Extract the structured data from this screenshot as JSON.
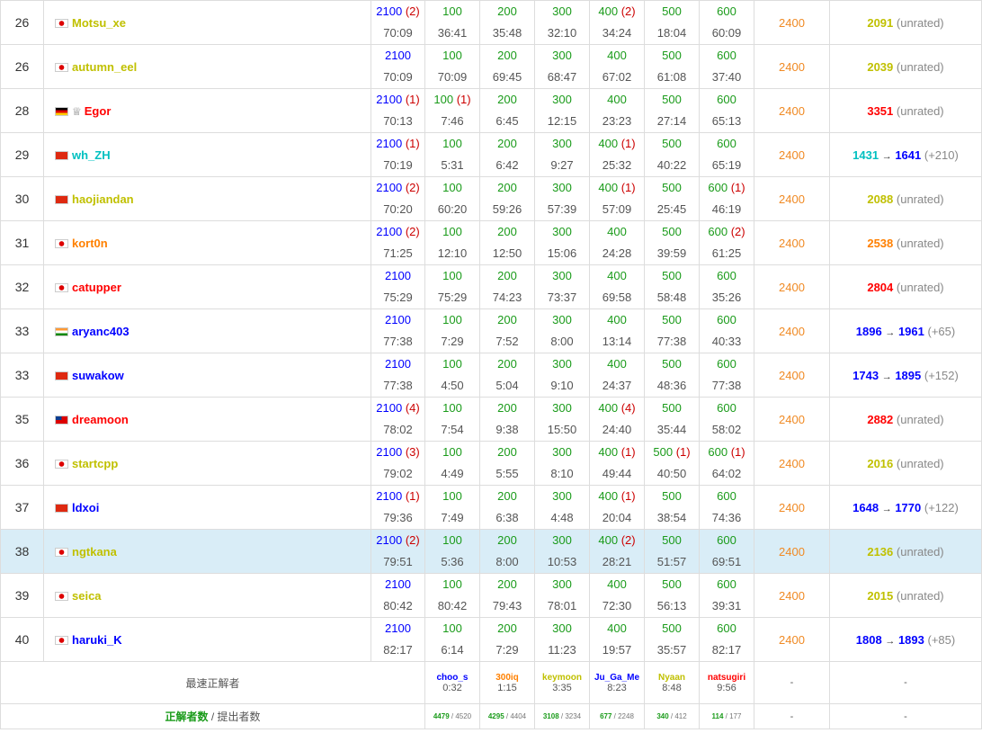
{
  "rows": [
    {
      "rank": "26",
      "flag": "jp",
      "crown": false,
      "name": "Motsu_xe",
      "color": "#c0c000",
      "highlight": false,
      "problems": [
        [
          "2100",
          "(2)",
          "70:09"
        ],
        [
          "100",
          "",
          "36:41"
        ],
        [
          "200",
          "",
          "35:48"
        ],
        [
          "300",
          "",
          "32:10"
        ],
        [
          "400",
          "(2)",
          "34:24"
        ],
        [
          "500",
          "",
          "18:04"
        ],
        [
          "600",
          "",
          "60:09"
        ]
      ],
      "score": "2400",
      "rating": {
        "perf": "2091",
        "perf_color": "#c0c000",
        "old": "",
        "new": "",
        "delta": "",
        "unrated": "(unrated)"
      }
    },
    {
      "rank": "26",
      "flag": "jp",
      "crown": false,
      "name": "autumn_eel",
      "color": "#c0c000",
      "highlight": false,
      "problems": [
        [
          "2100",
          "",
          "70:09"
        ],
        [
          "100",
          "",
          "70:09"
        ],
        [
          "200",
          "",
          "69:45"
        ],
        [
          "300",
          "",
          "68:47"
        ],
        [
          "400",
          "",
          "67:02"
        ],
        [
          "500",
          "",
          "61:08"
        ],
        [
          "600",
          "",
          "37:40"
        ]
      ],
      "score": "2400",
      "rating": {
        "perf": "2039",
        "perf_color": "#c0c000",
        "old": "",
        "new": "",
        "delta": "",
        "unrated": "(unrated)"
      }
    },
    {
      "rank": "28",
      "flag": "de",
      "crown": true,
      "name": "Egor",
      "color": "#ff0000",
      "highlight": false,
      "problems": [
        [
          "2100",
          "(1)",
          "70:13"
        ],
        [
          "100",
          "(1)",
          "7:46"
        ],
        [
          "200",
          "",
          "6:45"
        ],
        [
          "300",
          "",
          "12:15"
        ],
        [
          "400",
          "",
          "23:23"
        ],
        [
          "500",
          "",
          "27:14"
        ],
        [
          "600",
          "",
          "65:13"
        ]
      ],
      "score": "2400",
      "rating": {
        "perf": "3351",
        "perf_color": "#ff0000",
        "old": "",
        "new": "",
        "delta": "",
        "unrated": "(unrated)"
      }
    },
    {
      "rank": "29",
      "flag": "cn",
      "crown": false,
      "name": "wh_ZH",
      "color": "#00c0c0",
      "highlight": false,
      "problems": [
        [
          "2100",
          "(1)",
          "70:19"
        ],
        [
          "100",
          "",
          "5:31"
        ],
        [
          "200",
          "",
          "6:42"
        ],
        [
          "300",
          "",
          "9:27"
        ],
        [
          "400",
          "(1)",
          "25:32"
        ],
        [
          "500",
          "",
          "40:22"
        ],
        [
          "600",
          "",
          "65:19"
        ]
      ],
      "score": "2400",
      "rating": {
        "perf": "",
        "perf_color": "",
        "old": "1431",
        "old_color": "#00c0c0",
        "new": "1641",
        "new_color": "#0000ff",
        "delta": "(+210)",
        "unrated": ""
      }
    },
    {
      "rank": "30",
      "flag": "cn",
      "crown": false,
      "name": "haojiandan",
      "color": "#c0c000",
      "highlight": false,
      "problems": [
        [
          "2100",
          "(2)",
          "70:20"
        ],
        [
          "100",
          "",
          "60:20"
        ],
        [
          "200",
          "",
          "59:26"
        ],
        [
          "300",
          "",
          "57:39"
        ],
        [
          "400",
          "(1)",
          "57:09"
        ],
        [
          "500",
          "",
          "25:45"
        ],
        [
          "600",
          "(1)",
          "46:19"
        ]
      ],
      "score": "2400",
      "rating": {
        "perf": "2088",
        "perf_color": "#c0c000",
        "old": "",
        "new": "",
        "delta": "",
        "unrated": "(unrated)"
      }
    },
    {
      "rank": "31",
      "flag": "jp",
      "crown": false,
      "name": "kort0n",
      "color": "#ff8000",
      "highlight": false,
      "problems": [
        [
          "2100",
          "(2)",
          "71:25"
        ],
        [
          "100",
          "",
          "12:10"
        ],
        [
          "200",
          "",
          "12:50"
        ],
        [
          "300",
          "",
          "15:06"
        ],
        [
          "400",
          "",
          "24:28"
        ],
        [
          "500",
          "",
          "39:59"
        ],
        [
          "600",
          "(2)",
          "61:25"
        ]
      ],
      "score": "2400",
      "rating": {
        "perf": "2538",
        "perf_color": "#ff8000",
        "old": "",
        "new": "",
        "delta": "",
        "unrated": "(unrated)"
      }
    },
    {
      "rank": "32",
      "flag": "jp",
      "crown": false,
      "name": "catupper",
      "color": "#ff0000",
      "highlight": false,
      "problems": [
        [
          "2100",
          "",
          "75:29"
        ],
        [
          "100",
          "",
          "75:29"
        ],
        [
          "200",
          "",
          "74:23"
        ],
        [
          "300",
          "",
          "73:37"
        ],
        [
          "400",
          "",
          "69:58"
        ],
        [
          "500",
          "",
          "58:48"
        ],
        [
          "600",
          "",
          "35:26"
        ]
      ],
      "score": "2400",
      "rating": {
        "perf": "2804",
        "perf_color": "#ff0000",
        "old": "",
        "new": "",
        "delta": "",
        "unrated": "(unrated)"
      }
    },
    {
      "rank": "33",
      "flag": "in",
      "crown": false,
      "name": "aryanc403",
      "color": "#0000ff",
      "highlight": false,
      "problems": [
        [
          "2100",
          "",
          "77:38"
        ],
        [
          "100",
          "",
          "7:29"
        ],
        [
          "200",
          "",
          "7:52"
        ],
        [
          "300",
          "",
          "8:00"
        ],
        [
          "400",
          "",
          "13:14"
        ],
        [
          "500",
          "",
          "77:38"
        ],
        [
          "600",
          "",
          "40:33"
        ]
      ],
      "score": "2400",
      "rating": {
        "perf": "",
        "perf_color": "",
        "old": "1896",
        "old_color": "#0000ff",
        "new": "1961",
        "new_color": "#0000ff",
        "delta": "(+65)",
        "unrated": ""
      }
    },
    {
      "rank": "33",
      "flag": "cn",
      "crown": false,
      "name": "suwakow",
      "color": "#0000ff",
      "highlight": false,
      "problems": [
        [
          "2100",
          "",
          "77:38"
        ],
        [
          "100",
          "",
          "4:50"
        ],
        [
          "200",
          "",
          "5:04"
        ],
        [
          "300",
          "",
          "9:10"
        ],
        [
          "400",
          "",
          "24:37"
        ],
        [
          "500",
          "",
          "48:36"
        ],
        [
          "600",
          "",
          "77:38"
        ]
      ],
      "score": "2400",
      "rating": {
        "perf": "",
        "perf_color": "",
        "old": "1743",
        "old_color": "#0000ff",
        "new": "1895",
        "new_color": "#0000ff",
        "delta": "(+152)",
        "unrated": ""
      }
    },
    {
      "rank": "35",
      "flag": "tw",
      "crown": false,
      "name": "dreamoon",
      "color": "#ff0000",
      "highlight": false,
      "problems": [
        [
          "2100",
          "(4)",
          "78:02"
        ],
        [
          "100",
          "",
          "7:54"
        ],
        [
          "200",
          "",
          "9:38"
        ],
        [
          "300",
          "",
          "15:50"
        ],
        [
          "400",
          "(4)",
          "24:40"
        ],
        [
          "500",
          "",
          "35:44"
        ],
        [
          "600",
          "",
          "58:02"
        ]
      ],
      "score": "2400",
      "rating": {
        "perf": "2882",
        "perf_color": "#ff0000",
        "old": "",
        "new": "",
        "delta": "",
        "unrated": "(unrated)"
      }
    },
    {
      "rank": "36",
      "flag": "jp",
      "crown": false,
      "name": "startcpp",
      "color": "#c0c000",
      "highlight": false,
      "problems": [
        [
          "2100",
          "(3)",
          "79:02"
        ],
        [
          "100",
          "",
          "4:49"
        ],
        [
          "200",
          "",
          "5:55"
        ],
        [
          "300",
          "",
          "8:10"
        ],
        [
          "400",
          "(1)",
          "49:44"
        ],
        [
          "500",
          "(1)",
          "40:50"
        ],
        [
          "600",
          "(1)",
          "64:02"
        ]
      ],
      "score": "2400",
      "rating": {
        "perf": "2016",
        "perf_color": "#c0c000",
        "old": "",
        "new": "",
        "delta": "",
        "unrated": "(unrated)"
      }
    },
    {
      "rank": "37",
      "flag": "cn",
      "crown": false,
      "name": "ldxoi",
      "color": "#0000ff",
      "highlight": false,
      "problems": [
        [
          "2100",
          "(1)",
          "79:36"
        ],
        [
          "100",
          "",
          "7:49"
        ],
        [
          "200",
          "",
          "6:38"
        ],
        [
          "300",
          "",
          "4:48"
        ],
        [
          "400",
          "(1)",
          "20:04"
        ],
        [
          "500",
          "",
          "38:54"
        ],
        [
          "600",
          "",
          "74:36"
        ]
      ],
      "score": "2400",
      "rating": {
        "perf": "",
        "perf_color": "",
        "old": "1648",
        "old_color": "#0000ff",
        "new": "1770",
        "new_color": "#0000ff",
        "delta": "(+122)",
        "unrated": ""
      }
    },
    {
      "rank": "38",
      "flag": "jp",
      "crown": false,
      "name": "ngtkana",
      "color": "#c0c000",
      "highlight": true,
      "problems": [
        [
          "2100",
          "(2)",
          "79:51"
        ],
        [
          "100",
          "",
          "5:36"
        ],
        [
          "200",
          "",
          "8:00"
        ],
        [
          "300",
          "",
          "10:53"
        ],
        [
          "400",
          "(2)",
          "28:21"
        ],
        [
          "500",
          "",
          "51:57"
        ],
        [
          "600",
          "",
          "69:51"
        ]
      ],
      "score": "2400",
      "rating": {
        "perf": "2136",
        "perf_color": "#c0c000",
        "old": "",
        "new": "",
        "delta": "",
        "unrated": "(unrated)"
      }
    },
    {
      "rank": "39",
      "flag": "jp",
      "crown": false,
      "name": "seica",
      "color": "#c0c000",
      "highlight": false,
      "problems": [
        [
          "2100",
          "",
          "80:42"
        ],
        [
          "100",
          "",
          "80:42"
        ],
        [
          "200",
          "",
          "79:43"
        ],
        [
          "300",
          "",
          "78:01"
        ],
        [
          "400",
          "",
          "72:30"
        ],
        [
          "500",
          "",
          "56:13"
        ],
        [
          "600",
          "",
          "39:31"
        ]
      ],
      "score": "2400",
      "rating": {
        "perf": "2015",
        "perf_color": "#c0c000",
        "old": "",
        "new": "",
        "delta": "",
        "unrated": "(unrated)"
      }
    },
    {
      "rank": "40",
      "flag": "jp",
      "crown": false,
      "name": "haruki_K",
      "color": "#0000ff",
      "highlight": false,
      "problems": [
        [
          "2100",
          "",
          "82:17"
        ],
        [
          "100",
          "",
          "6:14"
        ],
        [
          "200",
          "",
          "7:29"
        ],
        [
          "300",
          "",
          "11:23"
        ],
        [
          "400",
          "",
          "19:57"
        ],
        [
          "500",
          "",
          "35:57"
        ],
        [
          "600",
          "",
          "82:17"
        ]
      ],
      "score": "2400",
      "rating": {
        "perf": "",
        "perf_color": "",
        "old": "1808",
        "old_color": "#0000ff",
        "new": "1893",
        "new_color": "#0000ff",
        "delta": "(+85)",
        "unrated": ""
      }
    }
  ],
  "fastest": {
    "label": "最速正解者",
    "entries": [
      {
        "name": "choo_s",
        "color": "#0000ff",
        "time": "0:32"
      },
      {
        "name": "300iq",
        "color": "#ff8000",
        "time": "1:15"
      },
      {
        "name": "keymoon",
        "color": "#c0c000",
        "time": "3:35"
      },
      {
        "name": "Ju_Ga_Me",
        "color": "#0000ff",
        "time": "8:23"
      },
      {
        "name": "Nyaan",
        "color": "#c0c000",
        "time": "8:48"
      },
      {
        "name": "natsugiri",
        "color": "#ff0000",
        "time": "9:56"
      }
    ],
    "dash1": "-",
    "dash2": "-"
  },
  "counts": {
    "label_main": "正解者数",
    "label_sep": " / ",
    "label_sub": "提出者数",
    "entries": [
      {
        "ac": "4479",
        "sub": " / 4520"
      },
      {
        "ac": "4295",
        "sub": " / 4404"
      },
      {
        "ac": "3108",
        "sub": " / 3234"
      },
      {
        "ac": "677",
        "sub": " / 2248"
      },
      {
        "ac": "340",
        "sub": " / 412"
      },
      {
        "ac": "114",
        "sub": " / 177"
      }
    ],
    "dash1": "-",
    "dash2": "-"
  }
}
